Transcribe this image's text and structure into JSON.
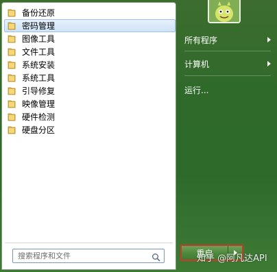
{
  "programs": [
    {
      "label": "备份还原",
      "icon": "folder-icon",
      "selected": false
    },
    {
      "label": "密码管理",
      "icon": "folder-icon",
      "selected": true
    },
    {
      "label": "图像工具",
      "icon": "folder-icon",
      "selected": false
    },
    {
      "label": "文件工具",
      "icon": "folder-icon",
      "selected": false
    },
    {
      "label": "系统安装",
      "icon": "folder-icon",
      "selected": false
    },
    {
      "label": "系统工具",
      "icon": "folder-icon",
      "selected": false
    },
    {
      "label": "引导修复",
      "icon": "folder-icon",
      "selected": false
    },
    {
      "label": "映像管理",
      "icon": "folder-icon",
      "selected": false
    },
    {
      "label": "硬件检测",
      "icon": "folder-icon",
      "selected": false
    },
    {
      "label": "硬盘分区",
      "icon": "folder-icon",
      "selected": false
    }
  ],
  "search": {
    "placeholder": "搜索程序和文件",
    "icon": "search-icon"
  },
  "right_menu": {
    "all_programs": "所有程序",
    "computer": "计算机",
    "run": "运行..."
  },
  "shutdown": {
    "label": "重启"
  },
  "watermark": "知乎 @阿凡达API",
  "colors": {
    "panel_bg": "#2f6a2a",
    "selected_bg": "#cfe3f8",
    "shutdown_border": "#c93a2a"
  }
}
